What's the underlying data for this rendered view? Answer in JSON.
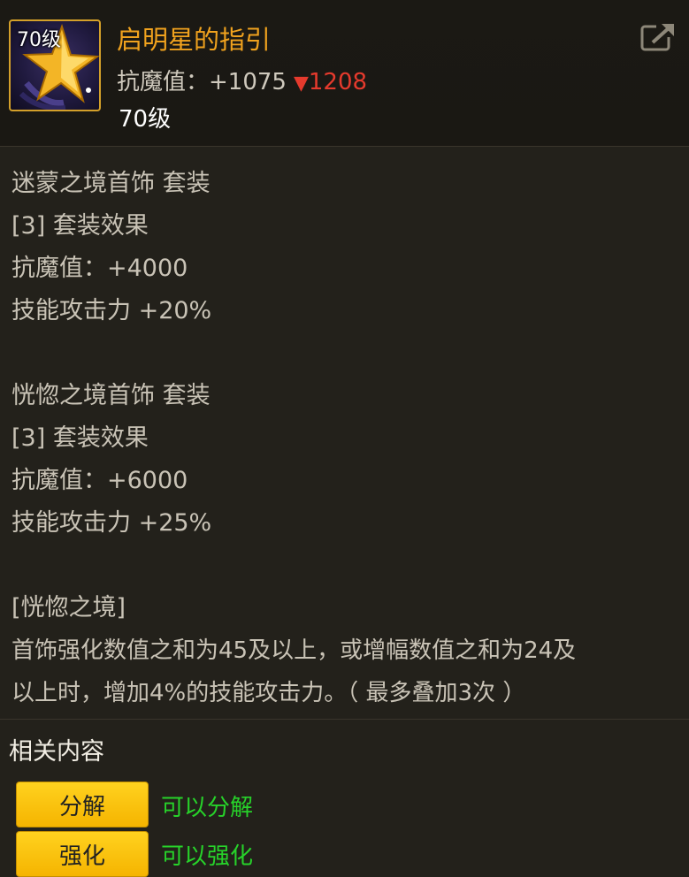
{
  "item": {
    "level_badge": "70级",
    "name": "启明星的指引",
    "resist_label": "抗魔值：",
    "resist_value": "+1075",
    "resist_down_arrow": "▼",
    "resist_compare": "1208",
    "req_level": "70级"
  },
  "icons": {
    "item_icon": "star-icon",
    "share": "share-icon"
  },
  "set_effects": [
    {
      "set_name": "迷蒙之境首饰  套装",
      "count_label": "[3] 套装效果",
      "stat1": "抗魔值：+4000",
      "stat2": "技能攻击力 +20%"
    },
    {
      "set_name": "恍惚之境首饰  套装",
      "count_label": "[3] 套装效果",
      "stat1": "抗魔值：+6000",
      "stat2": "技能攻击力 +25%"
    }
  ],
  "special": {
    "title": "[恍惚之境]",
    "line1": "首饰强化数值之和为45及以上，或增幅数值之和为24及",
    "line2": "以上时，增加4%的技能攻击力。（ 最多叠加3次 ）"
  },
  "related": {
    "title": "相关内容",
    "actions": [
      {
        "button": "分解",
        "status": "可以分解"
      },
      {
        "button": "强化",
        "status": "可以强化"
      }
    ]
  },
  "colors": {
    "title": "#f0a21e",
    "decrease": "#e53a2d",
    "ok": "#27d22a",
    "button": "#ffd21f"
  }
}
